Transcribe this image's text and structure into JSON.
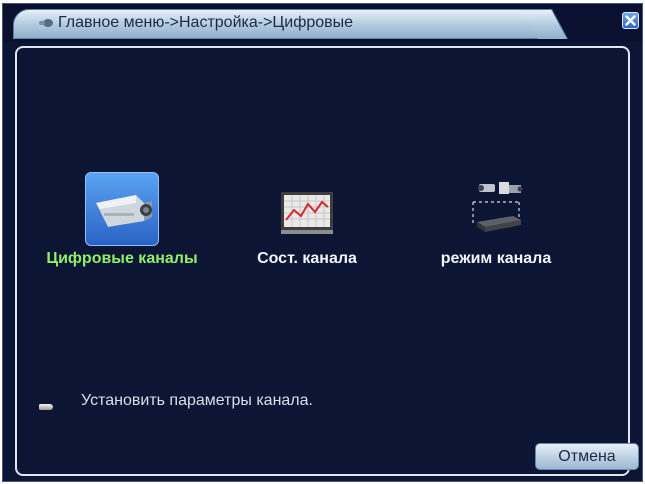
{
  "title": {
    "breadcrumb": "Главное меню->Настройка->Цифровые"
  },
  "menu": {
    "items": [
      {
        "label": "Цифровые каналы",
        "icon": "camera-icon",
        "selected": true
      },
      {
        "label": "Сост. канала",
        "icon": "chart-icon",
        "selected": false
      },
      {
        "label": "режим канала",
        "icon": "camera-dvr-icon",
        "selected": false
      }
    ]
  },
  "hint": {
    "text": "Установить параметры канала."
  },
  "buttons": {
    "cancel_label": "Отмена"
  },
  "colors": {
    "background": "#0d1535",
    "selected_label": "#8ff06a",
    "label": "#f2f5fa",
    "selected_tile": "#3b7fdc"
  }
}
